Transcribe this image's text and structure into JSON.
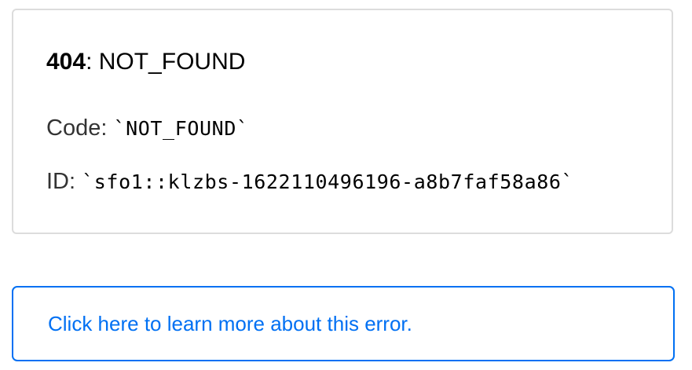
{
  "error": {
    "status_code": "404",
    "separator": ": ",
    "status_text": "NOT_FOUND",
    "code_label": "Code: ",
    "code_value": "`NOT_FOUND`",
    "id_label": "ID: ",
    "id_value": "`sfo1::klzbs-1622110496196-a8b7faf58a86`"
  },
  "help": {
    "link_text": "Click here to learn more about this error."
  },
  "colors": {
    "link": "#0070f3",
    "card_border": "#dcdcdc"
  }
}
